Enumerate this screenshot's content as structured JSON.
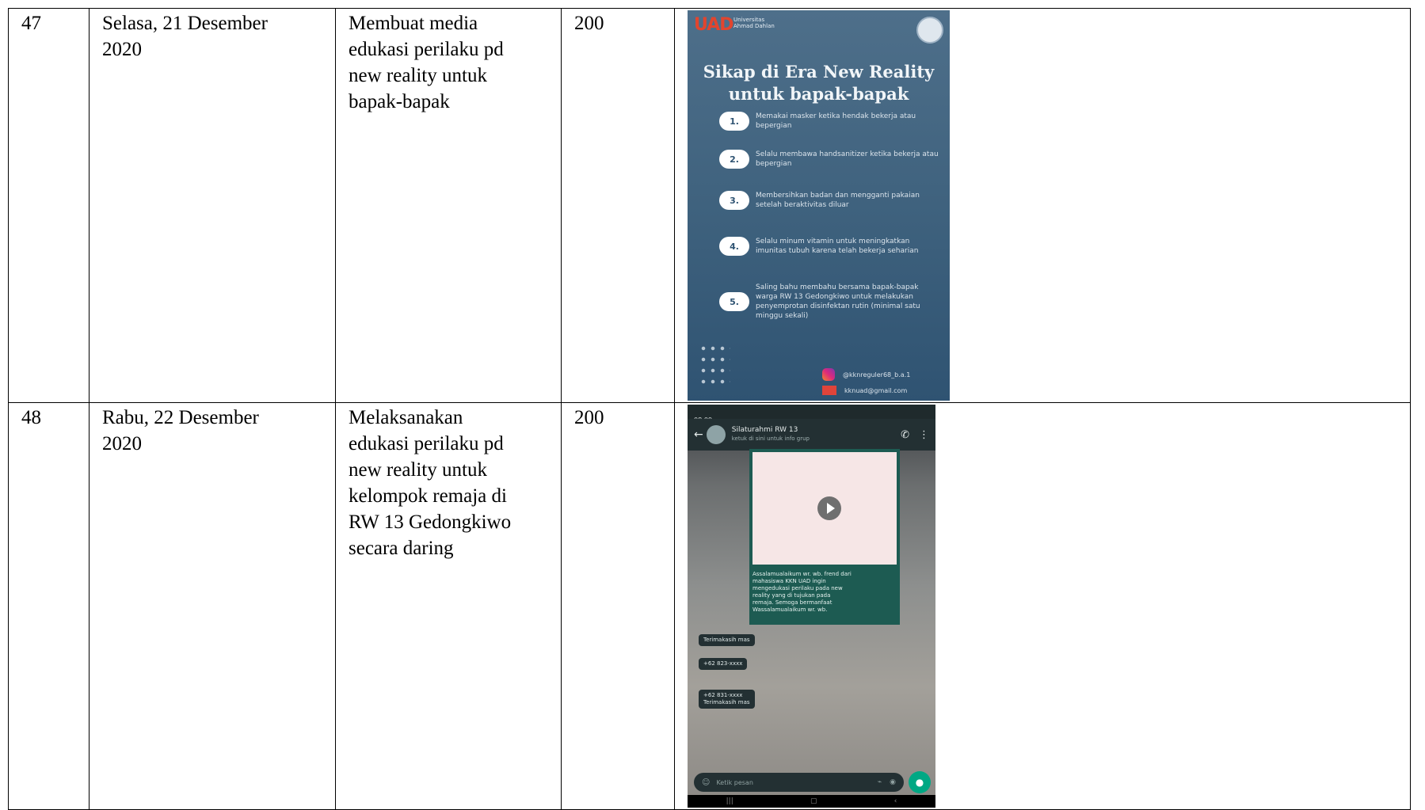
{
  "rows": [
    {
      "no": "47",
      "date": "Selasa, 21 Desember\n2020",
      "activity": "Membuat media\nedukasi perilaku pd\nnew reality untuk\nbapak-bapak",
      "duration": "200",
      "poster": {
        "logo": "UAD",
        "university": "Universitas\nAhmad Dahlan",
        "title": "Sikap di Era New Reality\nuntuk bapak-bapak",
        "items": [
          {
            "num": "1.",
            "text": "Memakai masker ketika hendak bekerja atau bepergian"
          },
          {
            "num": "2.",
            "text": "Selalu membawa handsanitizer ketika bekerja atau bepergian"
          },
          {
            "num": "3.",
            "text": "Membersihkan badan dan mengganti pakaian setelah beraktivitas diluar"
          },
          {
            "num": "4.",
            "text": "Selalu minum vitamin untuk meningkatkan imunitas tubuh karena telah bekerja seharian"
          },
          {
            "num": "5.",
            "text": "Saling bahu membahu bersama bapak-bapak warga RW 13 Gedongkiwo untuk melakukan penyemprotan disinfektan rutin (minimal satu minggu sekali)"
          }
        ],
        "instagram": "@kknreguler68_b.a.1",
        "email": "kknuad@gmail.com"
      }
    },
    {
      "no": "48",
      "date": "Rabu, 22 Desember\n2020",
      "activity": "Melaksanakan\nedukasi perilaku  pd\nnew reality untuk\nkelompok remaja di\nRW 13 Gedongkiwo\nsecara daring",
      "duration": "200",
      "chat": {
        "status": "08:09",
        "group_name": "Silaturahmi RW 13",
        "group_sub": "ketuk di sini untuk info grup",
        "caption": "Assalamualaikum wr. wb. frend dari\nmahasiswa KKN UAD ingin\nmengedukasi perilaku pada new\nreality yang di tujukan pada\nremaja. Semoga bermanfaat\nWassalamualaikum wr. wb.",
        "msg1": "Terimakasih mas",
        "msg2": "+62 823-xxxx",
        "msg3": "+62 831-xxxx\nTerimakasih mas",
        "input_placeholder": "Ketik pesan"
      }
    }
  ]
}
